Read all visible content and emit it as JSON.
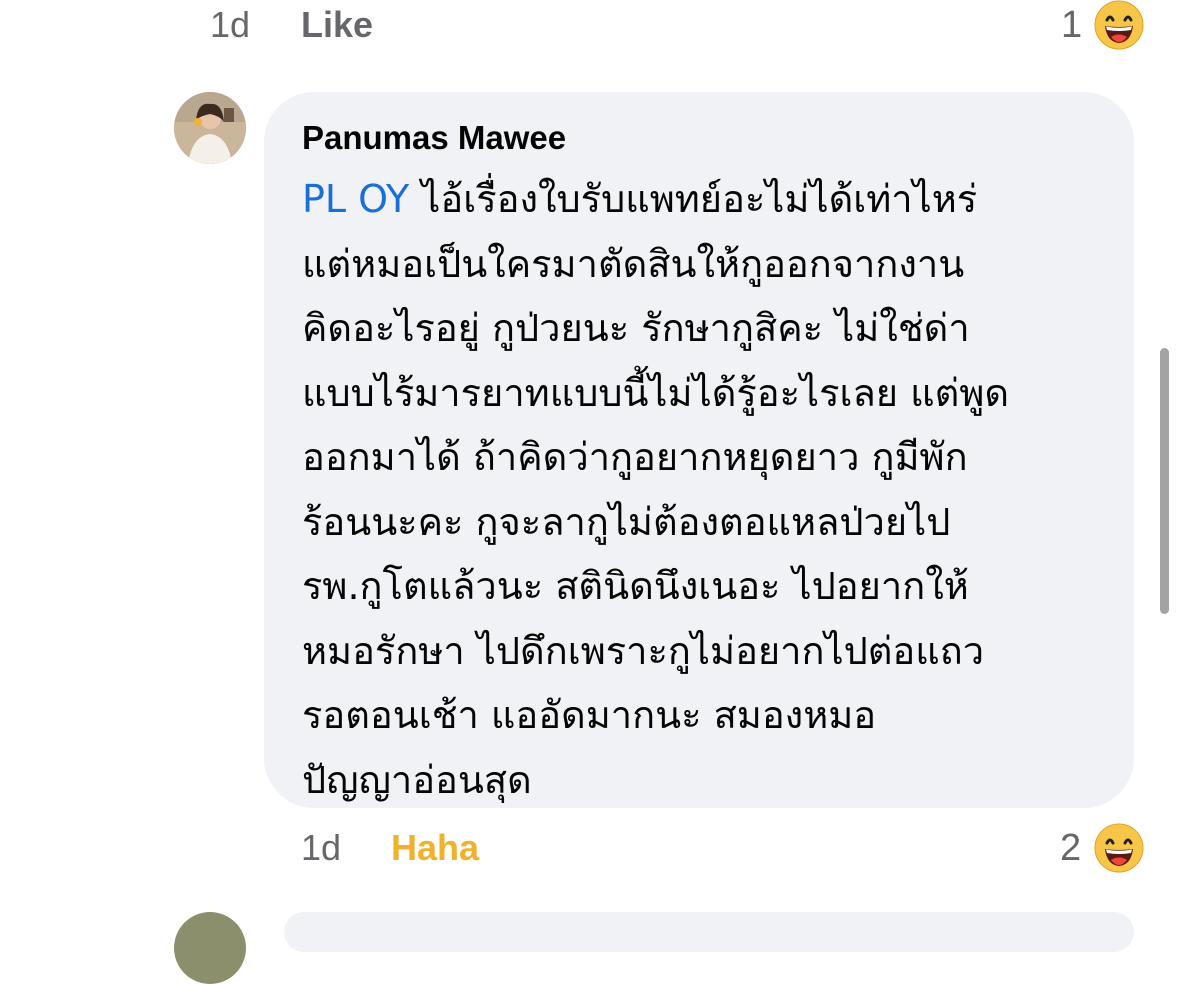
{
  "top_row": {
    "time": "1d",
    "action": "Like",
    "reaction_count": "1",
    "reaction_icon": "laughing-emoji-icon"
  },
  "comment": {
    "author": "Panumas Mawee",
    "mention": "PL OY",
    "lines": [
      " ไอ้เรื่องใบรับแพทย์อะไม่ได้เท่าไหร่",
      "แต่หมอเป็นใครมาตัดสินให้กูออกจากงาน",
      "คิดอะไรอยู่ กูป่วยนะ รักษากูสิคะ ไม่ใช่ด่า",
      "แบบไร้มารยาทแบบนี้ไม่ได้รู้อะไรเลย แต่พูด",
      "ออกมาได้ ถ้าคิดว่ากูอยากหยุดยาว กูมีพัก",
      "ร้อนนะคะ กูจะลากูไม่ต้องตอแหลป่วยไป",
      "รพ.กูโตแล้วนะ สตินิดนึงเนอะ ไปอยากให้",
      "หมอรักษา ไปดึกเพราะกูไม่อยากไปต่อแถว",
      "รอตอนเช้า แออัดมากนะ สมองหมอ",
      "ปัญญาอ่อนสุด"
    ],
    "time": "1d",
    "reaction_label": "Haha",
    "reaction_count": "2",
    "reaction_icon": "laughing-emoji-icon"
  },
  "colors": {
    "bubble": "#f0f2f5",
    "mention": "#1a6ed8",
    "haha": "#f0b12d",
    "muted": "#65676b",
    "like": "#65676b"
  }
}
